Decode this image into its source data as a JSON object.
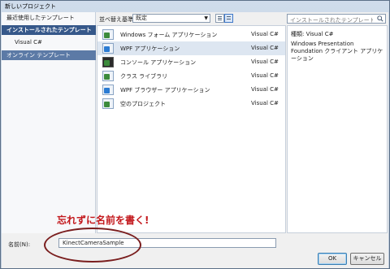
{
  "window": {
    "title": "新しいプロジェクト"
  },
  "nav": {
    "recent": "最近使用したテンプレート",
    "installed": "インストールされたテンプレート",
    "visual_csharp": "Visual C#",
    "online": "オンライン テンプレート"
  },
  "toolbar": {
    "sort_label": "並べ替え基準:",
    "sort_value": "既定"
  },
  "templates": [
    {
      "name": "Windows フォーム アプリケーション",
      "lang": "Visual C#"
    },
    {
      "name": "WPF アプリケーション",
      "lang": "Visual C#"
    },
    {
      "name": "コンソール アプリケーション",
      "lang": "Visual C#"
    },
    {
      "name": "クラス ライブラリ",
      "lang": "Visual C#"
    },
    {
      "name": "WPF ブラウザー アプリケーション",
      "lang": "Visual C#"
    },
    {
      "name": "空のプロジェクト",
      "lang": "Visual C#"
    }
  ],
  "search": {
    "placeholder": "インストールされたテンプレート の検索"
  },
  "description": {
    "type": "種類:  Visual C#",
    "text": "Windows Presentation Foundation クライアント アプリケーション"
  },
  "annotation": "忘れずに名前を書く!",
  "name_field": {
    "label": "名前(N):",
    "value": "KinectCameraSample"
  },
  "buttons": {
    "ok": "OK",
    "cancel": "キャンセル"
  },
  "selected_template_index": 1
}
